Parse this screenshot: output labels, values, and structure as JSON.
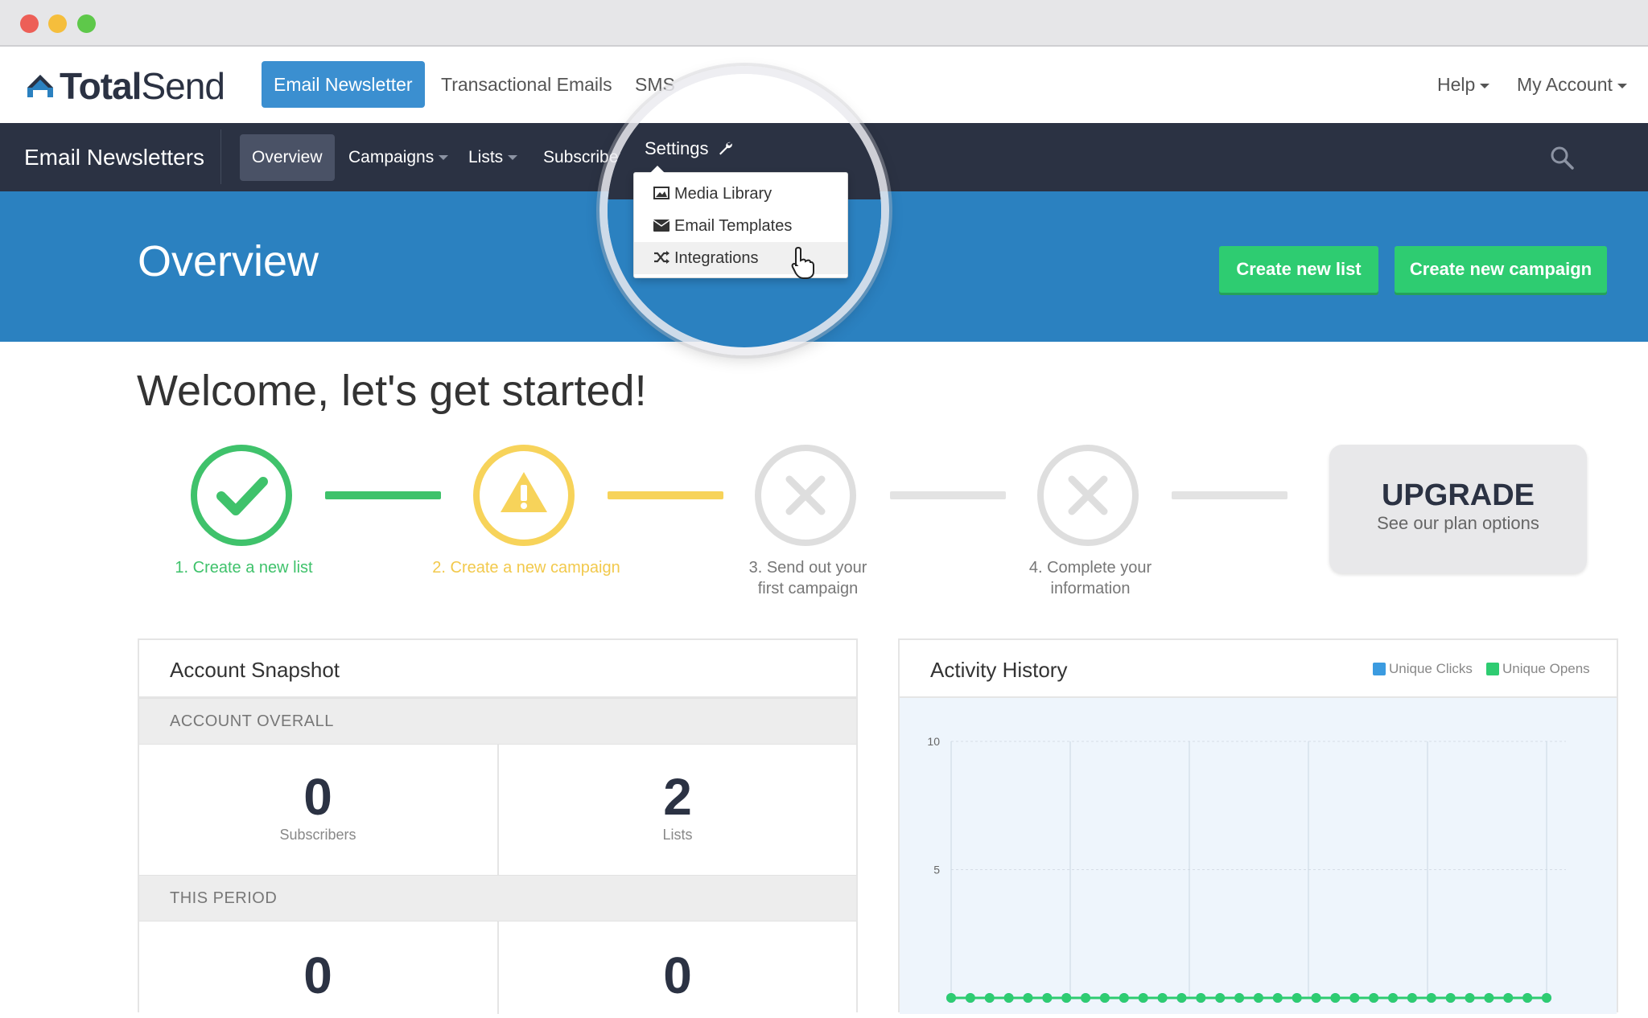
{
  "window": {
    "traffic_lights": {
      "close": "#ed5f57",
      "minimize": "#f5be3c",
      "maximize": "#5ec84a"
    }
  },
  "brand": {
    "logo_bold": "Total",
    "logo_light": "Send",
    "color": "#2b3243"
  },
  "topnav": {
    "tabs": [
      {
        "label": "Email Newsletter",
        "active": true
      },
      {
        "label": "Transactional Emails",
        "active": false
      },
      {
        "label": "SMS",
        "active": false
      }
    ],
    "right": [
      {
        "label": "Help"
      },
      {
        "label": "My Account"
      }
    ]
  },
  "subnav": {
    "title": "Email Newsletters",
    "items": [
      {
        "label": "Overview",
        "active": true
      },
      {
        "label": "Campaigns",
        "dropdown": true
      },
      {
        "label": "Lists",
        "dropdown": true
      },
      {
        "label": "Subscribers"
      }
    ],
    "settings": {
      "label": "Settings",
      "icon": "wrench-icon"
    },
    "search_icon": "search-icon"
  },
  "settings_menu": {
    "items": [
      {
        "label": "Media Library",
        "icon": "image-icon"
      },
      {
        "label": "Email Templates",
        "icon": "envelope-icon"
      },
      {
        "label": "Integrations",
        "icon": "shuffle-icon",
        "hovered": true
      }
    ]
  },
  "hero": {
    "title": "Overview",
    "buttons": [
      {
        "label": "Create new list"
      },
      {
        "label": "Create new campaign"
      }
    ]
  },
  "welcome": {
    "title": "Welcome, let's get started!"
  },
  "steps": [
    {
      "label": "1. Create a new list",
      "status": "done",
      "color": "#3fc26b",
      "icon": "check-icon"
    },
    {
      "label": "2. Create a new campaign",
      "status": "warning",
      "color": "#f7d35a",
      "icon": "warning-icon"
    },
    {
      "label": "3. Send out your first campaign",
      "status": "todo",
      "color": "#dedede",
      "icon": "x-icon"
    },
    {
      "label": "4. Complete your information",
      "status": "todo",
      "color": "#dedede",
      "icon": "x-icon"
    }
  ],
  "upgrade": {
    "title": "UPGRADE",
    "subtitle": "See our plan options"
  },
  "account_snapshot": {
    "title": "Account Snapshot",
    "overall": {
      "heading": "ACCOUNT OVERALL",
      "stats": [
        {
          "value": "0",
          "label": "Subscribers"
        },
        {
          "value": "2",
          "label": "Lists"
        }
      ]
    },
    "this_period": {
      "heading": "THIS PERIOD",
      "stats": [
        {
          "value": "0"
        },
        {
          "value": "0"
        }
      ]
    }
  },
  "activity": {
    "title": "Activity History",
    "legend": [
      {
        "name": "Unique Clicks",
        "color": "#3b9be0"
      },
      {
        "name": "Unique Opens",
        "color": "#2ecc71"
      }
    ]
  },
  "chart_data": {
    "type": "line",
    "ylim": [
      0,
      10
    ],
    "yticks": [
      "10",
      "5"
    ],
    "x_count": 32,
    "series": [
      {
        "name": "Unique Clicks",
        "values": [
          0,
          0,
          0,
          0,
          0,
          0,
          0,
          0,
          0,
          0,
          0,
          0,
          0,
          0,
          0,
          0,
          0,
          0,
          0,
          0,
          0,
          0,
          0,
          0,
          0,
          0,
          0,
          0,
          0,
          0,
          0,
          0
        ]
      },
      {
        "name": "Unique Opens",
        "values": [
          0,
          0,
          0,
          0,
          0,
          0,
          0,
          0,
          0,
          0,
          0,
          0,
          0,
          0,
          0,
          0,
          0,
          0,
          0,
          0,
          0,
          0,
          0,
          0,
          0,
          0,
          0,
          0,
          0,
          0,
          0,
          0
        ]
      }
    ],
    "grid": true,
    "legend": "top-right"
  }
}
